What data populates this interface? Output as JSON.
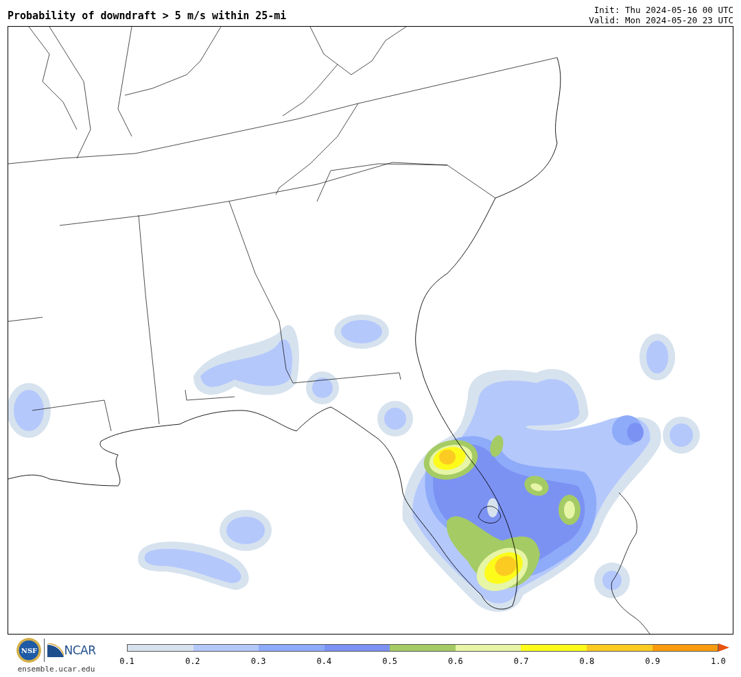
{
  "title": "Probability of downdraft > 5 m/s within 25-mi",
  "run_info": [
    "Init: Thu 2024-05-16 00 UTC",
    "Valid: Mon 2024-05-20 23 UTC"
  ],
  "logos": {
    "nsf": "NSF",
    "ncar": "NCAR",
    "site": "ensemble.ucar.edu"
  },
  "colorbar": {
    "bins": [
      {
        "color": "#d6e2ee"
      },
      {
        "color": "#b4c8fc"
      },
      {
        "color": "#8eabf9"
      },
      {
        "color": "#7b92f3"
      },
      {
        "color": "#a5cb64"
      },
      {
        "color": "#e7f5a6"
      },
      {
        "color": "#fdfb1a"
      },
      {
        "color": "#fccb22"
      },
      {
        "color": "#f99b0e"
      }
    ],
    "extend": {
      "color": "#e8530f"
    },
    "ticks": [
      "0.1",
      "0.2",
      "0.3",
      "0.4",
      "0.5",
      "0.6",
      "0.7",
      "0.8",
      "0.9",
      "1.0"
    ]
  }
}
